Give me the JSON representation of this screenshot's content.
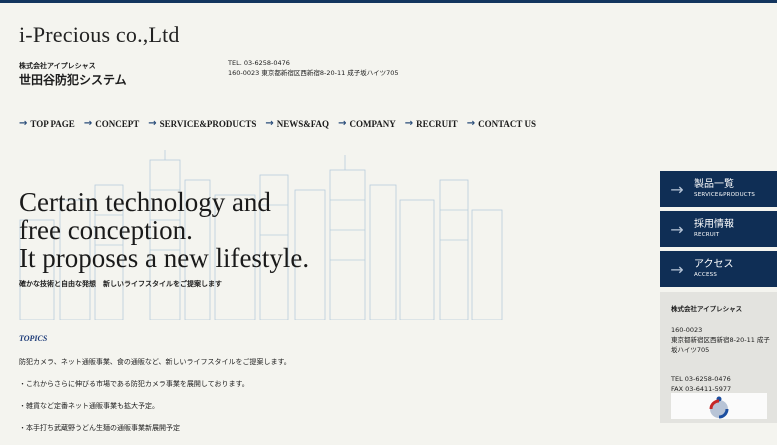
{
  "header": {
    "logo": "i-Precious co.,Ltd",
    "company_kana": "株式会社アイプレシャス",
    "site_name": "世田谷防犯システム",
    "tel": "TEL. 03-6258-0476",
    "address": "160-0023 東京都新宿区西新宿8-20-11 成子坂ハイツ705"
  },
  "nav": {
    "items": [
      "TOP PAGE",
      "CONCEPT",
      "SERVICE&PRODUCTS",
      "NEWS&FAQ",
      "COMPANY",
      "RECRUIT",
      "CONTACT US"
    ]
  },
  "hero": {
    "line1": "Certain technology and",
    "line2": "free conception.",
    "line3": "It proposes a new lifestyle.",
    "subtitle": "確かな技術と自由な発想　新しいライフスタイルをご提案します"
  },
  "topics": {
    "title": "TOPICS",
    "items": [
      "防犯カメラ、ネット通販事業、食の通販など、新しいライフスタイルをご提案します。",
      "・これからさらに伸びる市場である防犯カメラ事業を展開しております。",
      "・雑貨など定番ネット通販事業も拡大予定。",
      "・本手打ち武蔵野うどん生麺の通販事業新展開予定"
    ]
  },
  "sidebar": {
    "buttons": [
      {
        "jp": "製品一覧",
        "en": "SERVICE&PRODUCTS"
      },
      {
        "jp": "採用情報",
        "en": "RECRUIT"
      },
      {
        "jp": "アクセス",
        "en": "ACCESS"
      }
    ],
    "info": {
      "name": "株式会社アイプレシャス",
      "postal": "160-0023",
      "address": "東京都新宿区西新宿8-20-11 成子坂ハイツ705",
      "tel": "TEL 03-6258-0476",
      "fax": "FAX 03-6411-5977"
    }
  },
  "colors": {
    "navy": "#0f2e55",
    "accent": "#1d3b78",
    "background": "#f4f4ef"
  }
}
